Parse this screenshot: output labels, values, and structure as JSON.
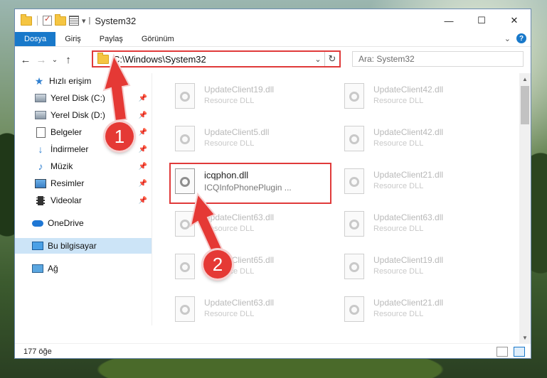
{
  "window": {
    "title": "System32"
  },
  "caption": {
    "minimize": "—",
    "maximize": "☐",
    "close": "✕"
  },
  "ribbon": {
    "tabs": [
      "Dosya",
      "Giriş",
      "Paylaş",
      "Görünüm"
    ],
    "active_tab": "Dosya",
    "help": "?"
  },
  "address": {
    "path": "C:\\Windows\\System32",
    "search_placeholder": "Ara: System32"
  },
  "nav": {
    "items": [
      {
        "label": "Hızlı erişim",
        "icon": "star-icon",
        "pinned": false
      },
      {
        "label": "Yerel Disk (C:)",
        "icon": "drive-icon",
        "pinned": true
      },
      {
        "label": "Yerel Disk (D:)",
        "icon": "drive-icon",
        "pinned": true
      },
      {
        "label": "Belgeler",
        "icon": "document-icon",
        "pinned": true
      },
      {
        "label": "İndirmeler",
        "icon": "download-icon",
        "pinned": true
      },
      {
        "label": "Müzik",
        "icon": "music-icon",
        "pinned": true
      },
      {
        "label": "Resimler",
        "icon": "pictures-icon",
        "pinned": true
      },
      {
        "label": "Videolar",
        "icon": "video-icon",
        "pinned": true
      },
      {
        "label": "OneDrive",
        "icon": "cloud-icon",
        "pinned": false
      },
      {
        "label": "Bu bilgisayar",
        "icon": "computer-icon",
        "pinned": false,
        "selected": true
      },
      {
        "label": "Ağ",
        "icon": "network-icon",
        "pinned": false
      }
    ]
  },
  "files": [
    {
      "name": "UpdateClient19.dll",
      "type": "Resource DLL"
    },
    {
      "name": "UpdateClient42.dll",
      "type": "Resource DLL"
    },
    {
      "name": "UpdateClient5.dll",
      "type": "Resource DLL"
    },
    {
      "name": "UpdateClient42.dll",
      "type": "Resource DLL"
    },
    {
      "name": "icqphon.dll",
      "type": "ICQInfoPhonePlugin ...",
      "highlighted": true
    },
    {
      "name": "UpdateClient21.dll",
      "type": "Resource DLL"
    },
    {
      "name": "UpdateClient63.dll",
      "type": "Resource DLL"
    },
    {
      "name": "UpdateClient63.dll",
      "type": "Resource DLL"
    },
    {
      "name": "UpdateClient65.dll",
      "type": "Resource DLL"
    },
    {
      "name": "UpdateClient19.dll",
      "type": "Resource DLL"
    },
    {
      "name": "UpdateClient63.dll",
      "type": "Resource DLL"
    },
    {
      "name": "UpdateClient21.dll",
      "type": "Resource DLL"
    }
  ],
  "status": {
    "count": "177 öğe"
  },
  "annotations": {
    "step1": "1",
    "step2": "2"
  },
  "colors": {
    "accent": "#1979ca",
    "highlight_border": "#e03a3a",
    "badge": "#e53935",
    "nav_selected": "#cce4f7"
  }
}
